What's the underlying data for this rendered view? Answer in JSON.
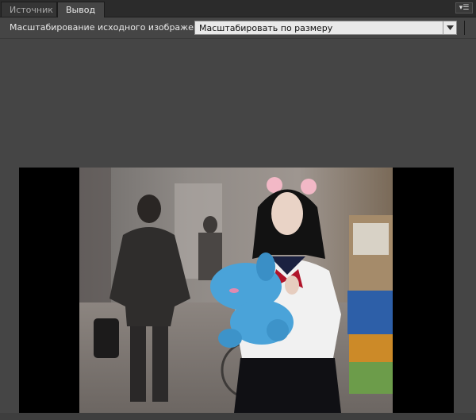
{
  "tabs": [
    {
      "label": "Источник",
      "active": false
    },
    {
      "label": "Вывод",
      "active": true
    }
  ],
  "panel_menu": {
    "icon": "panel-menu-icon"
  },
  "scaling": {
    "label": "Масштабирование исходного изображения:",
    "selected": "Масштабировать по размеру",
    "dropdown_icon": "chevron-down-icon"
  },
  "preview": {
    "description_icon": "video-frame",
    "colors": {
      "panel": "#454545",
      "letterbox": "#000000",
      "tabbar": "#2b2b2b"
    }
  }
}
